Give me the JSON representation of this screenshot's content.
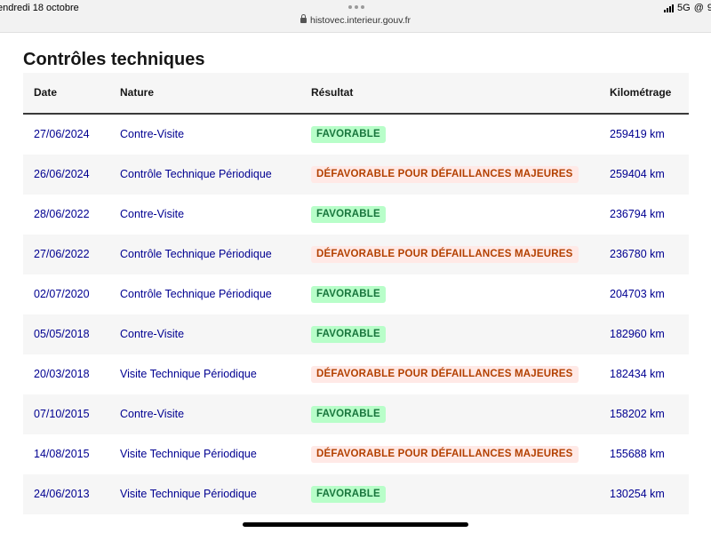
{
  "status_bar": {
    "time": "endredi 18 octobre",
    "url": "histovec.interieur.gouv.fr",
    "network": "5G",
    "battery": "9"
  },
  "page": {
    "title": "Contrôles techniques"
  },
  "table": {
    "headers": {
      "date": "Date",
      "nature": "Nature",
      "result": "Résultat",
      "km": "Kilométrage"
    },
    "rows": [
      {
        "date": "27/06/2024",
        "nature": "Contre-Visite",
        "result": "FAVORABLE",
        "status": "ok",
        "km": "259419 km"
      },
      {
        "date": "26/06/2024",
        "nature": "Contrôle Technique Périodique",
        "result": "DÉFAVORABLE POUR DÉFAILLANCES MAJEURES",
        "status": "ko",
        "km": "259404 km"
      },
      {
        "date": "28/06/2022",
        "nature": "Contre-Visite",
        "result": "FAVORABLE",
        "status": "ok",
        "km": "236794 km"
      },
      {
        "date": "27/06/2022",
        "nature": "Contrôle Technique Périodique",
        "result": "DÉFAVORABLE POUR DÉFAILLANCES MAJEURES",
        "status": "ko",
        "km": "236780 km"
      },
      {
        "date": "02/07/2020",
        "nature": "Contrôle Technique Périodique",
        "result": "FAVORABLE",
        "status": "ok",
        "km": "204703 km"
      },
      {
        "date": "05/05/2018",
        "nature": "Contre-Visite",
        "result": "FAVORABLE",
        "status": "ok",
        "km": "182960 km"
      },
      {
        "date": "20/03/2018",
        "nature": "Visite Technique Périodique",
        "result": "DÉFAVORABLE POUR DÉFAILLANCES MAJEURES",
        "status": "ko",
        "km": "182434 km"
      },
      {
        "date": "07/10/2015",
        "nature": "Contre-Visite",
        "result": "FAVORABLE",
        "status": "ok",
        "km": "158202 km"
      },
      {
        "date": "14/08/2015",
        "nature": "Visite Technique Périodique",
        "result": "DÉFAVORABLE POUR DÉFAILLANCES MAJEURES",
        "status": "ko",
        "km": "155688 km"
      },
      {
        "date": "24/06/2013",
        "nature": "Visite Technique Périodique",
        "result": "FAVORABLE",
        "status": "ok",
        "km": "130254 km"
      }
    ]
  },
  "colors": {
    "link": "#000091",
    "ok_bg": "#b8fec9",
    "ok_text": "#18753c",
    "ko_bg": "#ffe9e6",
    "ko_text": "#b34000"
  }
}
